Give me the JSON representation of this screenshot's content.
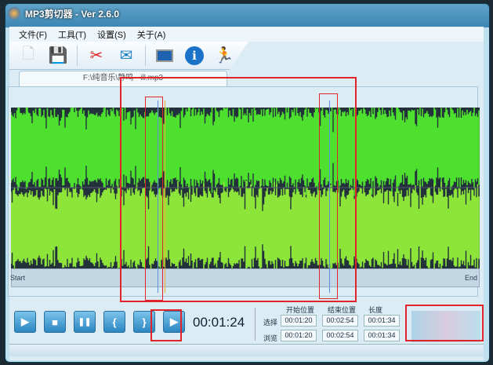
{
  "window": {
    "title": "MP3剪切器 - Ver 2.6.0"
  },
  "menu": [
    "文件(F)",
    "工具(T)",
    "设置(S)",
    "关于(A)"
  ],
  "toolbar": {
    "icons": [
      "new-file-icon",
      "save-icon",
      "cut-scissors-icon",
      "email-icon",
      "window-icon",
      "info-icon",
      "run-icon"
    ]
  },
  "tab": {
    "label": "F:\\纯音乐\\静鸣 - ill.mp3"
  },
  "ruler": {
    "start": "Start",
    "end": "End"
  },
  "controls": {
    "play": "▶",
    "stop": "■",
    "pause": "❚❚",
    "mark_start": "{",
    "mark_end": "}",
    "play_selection": "▶"
  },
  "current_time": "00:01:24",
  "fields": {
    "headers": [
      "开始位置",
      "结束位置",
      "长度"
    ],
    "rows": [
      {
        "label": "选择",
        "values": [
          "00:01:20",
          "00:02:54",
          "00:01:34"
        ]
      },
      {
        "label": "浏览",
        "values": [
          "00:01:20",
          "00:02:54",
          "00:01:34"
        ]
      }
    ]
  },
  "colors": {
    "wave_top": "#4ee02f",
    "wave_bottom": "#8ee53a",
    "wave_bg": "#23323a",
    "annotation": "#e0242a"
  }
}
